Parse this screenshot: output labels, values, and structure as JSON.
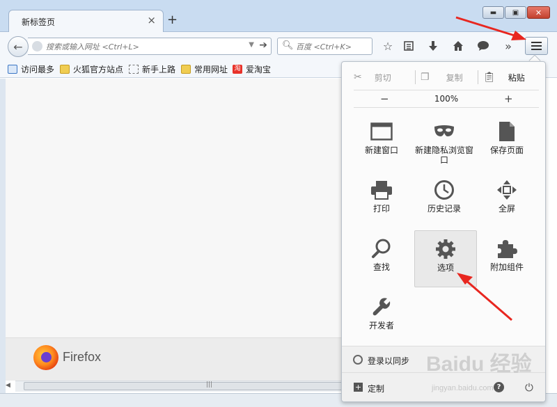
{
  "browser": {
    "tab_title": "新标签页",
    "tab_close": "×",
    "new_tab": "+",
    "window_buttons": {
      "minimize": "▬",
      "maximize": "▣",
      "close": "✕"
    }
  },
  "navbar": {
    "back": "←",
    "url_placeholder": "搜索或输入网址 <Ctrl+L>",
    "search_placeholder": "百度 <Ctrl+K>",
    "overflow": "»"
  },
  "bookmarks": [
    {
      "label": "访问最多",
      "icon": "most-visited-icon"
    },
    {
      "label": "火狐官方站点",
      "icon": "folder-icon"
    },
    {
      "label": "新手上路",
      "icon": "getting-started-icon"
    },
    {
      "label": "常用网址",
      "icon": "folder-icon"
    },
    {
      "label": "爱淘宝",
      "icon": "taobao-icon",
      "icon_text": "淘"
    }
  ],
  "footer": {
    "brand": "Firefox"
  },
  "menu": {
    "edit": {
      "cut": "剪切",
      "copy": "复制",
      "paste": "粘贴"
    },
    "zoom": {
      "minus": "−",
      "value": "100%",
      "plus": "+"
    },
    "items": [
      {
        "label": "新建窗口",
        "icon": "new-window-icon"
      },
      {
        "label": "新建隐私浏览窗口",
        "icon": "private-window-icon"
      },
      {
        "label": "保存页面",
        "icon": "save-page-icon"
      },
      {
        "label": "打印",
        "icon": "print-icon"
      },
      {
        "label": "历史记录",
        "icon": "history-icon"
      },
      {
        "label": "全屏",
        "icon": "fullscreen-icon"
      },
      {
        "label": "查找",
        "icon": "find-icon"
      },
      {
        "label": "选项",
        "icon": "options-gear-icon",
        "active": true
      },
      {
        "label": "附加组件",
        "icon": "addons-puzzle-icon"
      },
      {
        "label": "开发者",
        "icon": "developer-wrench-icon"
      }
    ],
    "sync": "登录以同步",
    "customize": "定制",
    "help": "?"
  },
  "watermark": {
    "main": "Baidu 经验",
    "sub": "jingyan.baidu.com"
  },
  "colors": {
    "annotation_arrow": "#e8261f",
    "titlebar": "#c9dcf1",
    "firefox_orange": "#ff8b1f"
  }
}
